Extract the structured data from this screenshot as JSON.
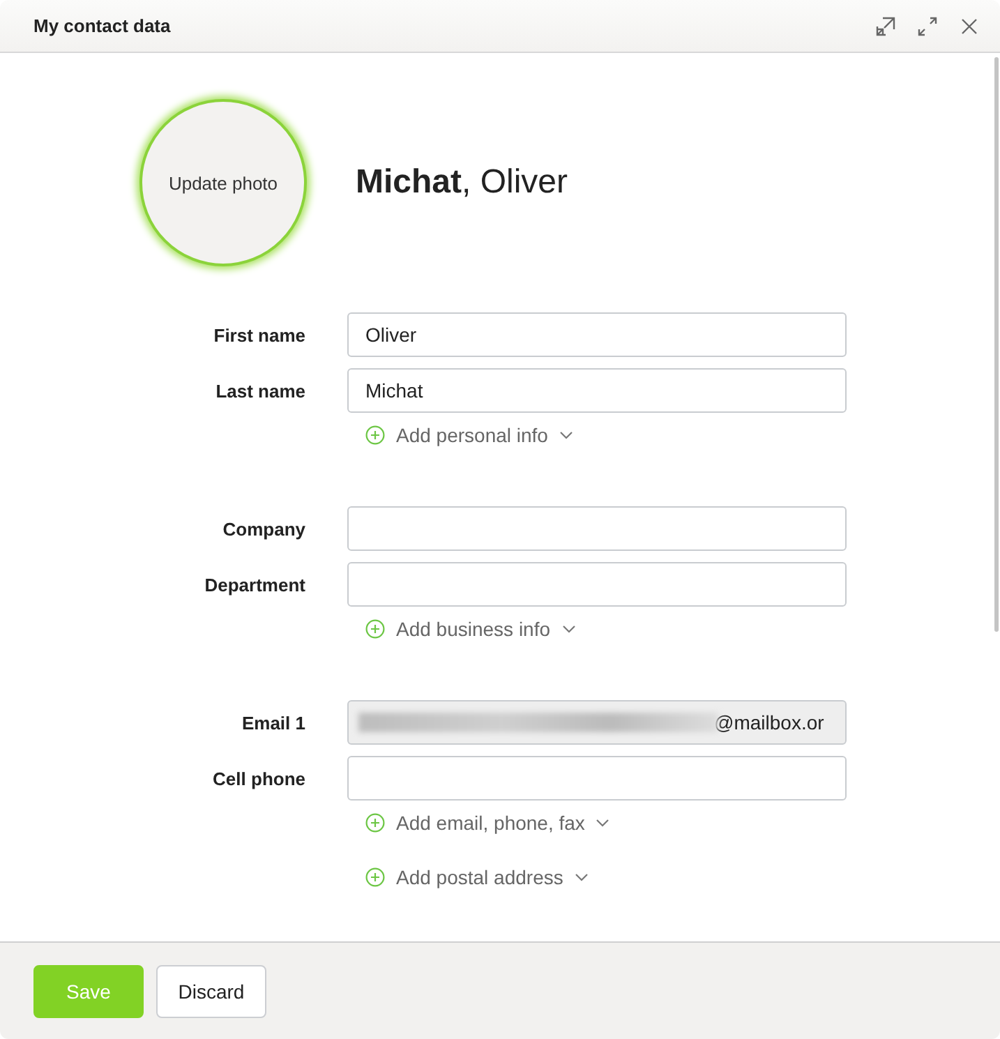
{
  "window": {
    "title": "My contact data"
  },
  "photo": {
    "label": "Update photo"
  },
  "display_name": "**Michat**, Oliver",
  "sections": [
    {
      "fields": [
        {
          "label": "First name",
          "value": "Oliver",
          "disabled": false,
          "redacted": false
        },
        {
          "label": "Last name",
          "value": "Michat",
          "disabled": false,
          "redacted": false
        }
      ],
      "link": "Add personal info"
    },
    {
      "fields": [
        {
          "label": "Company",
          "disabled": false,
          "redacted": false
        },
        {
          "label": "Department",
          "disabled": false,
          "redacted": false
        }
      ],
      "link": "Add business info"
    },
    {
      "fields": [
        {
          "label": "Email 1",
          "value": "@mailbox.or",
          "disabled": true,
          "redacted": true
        },
        {
          "label": "Cell phone",
          "disabled": false,
          "redacted": false
        }
      ],
      "link": "Add email, phone, fax"
    },
    {
      "link": "Add postal address"
    }
  ],
  "buttons": [
    {
      "label": "Save",
      "kind": "primary"
    },
    {
      "label": "Discard",
      "kind": "secondary"
    }
  ]
}
